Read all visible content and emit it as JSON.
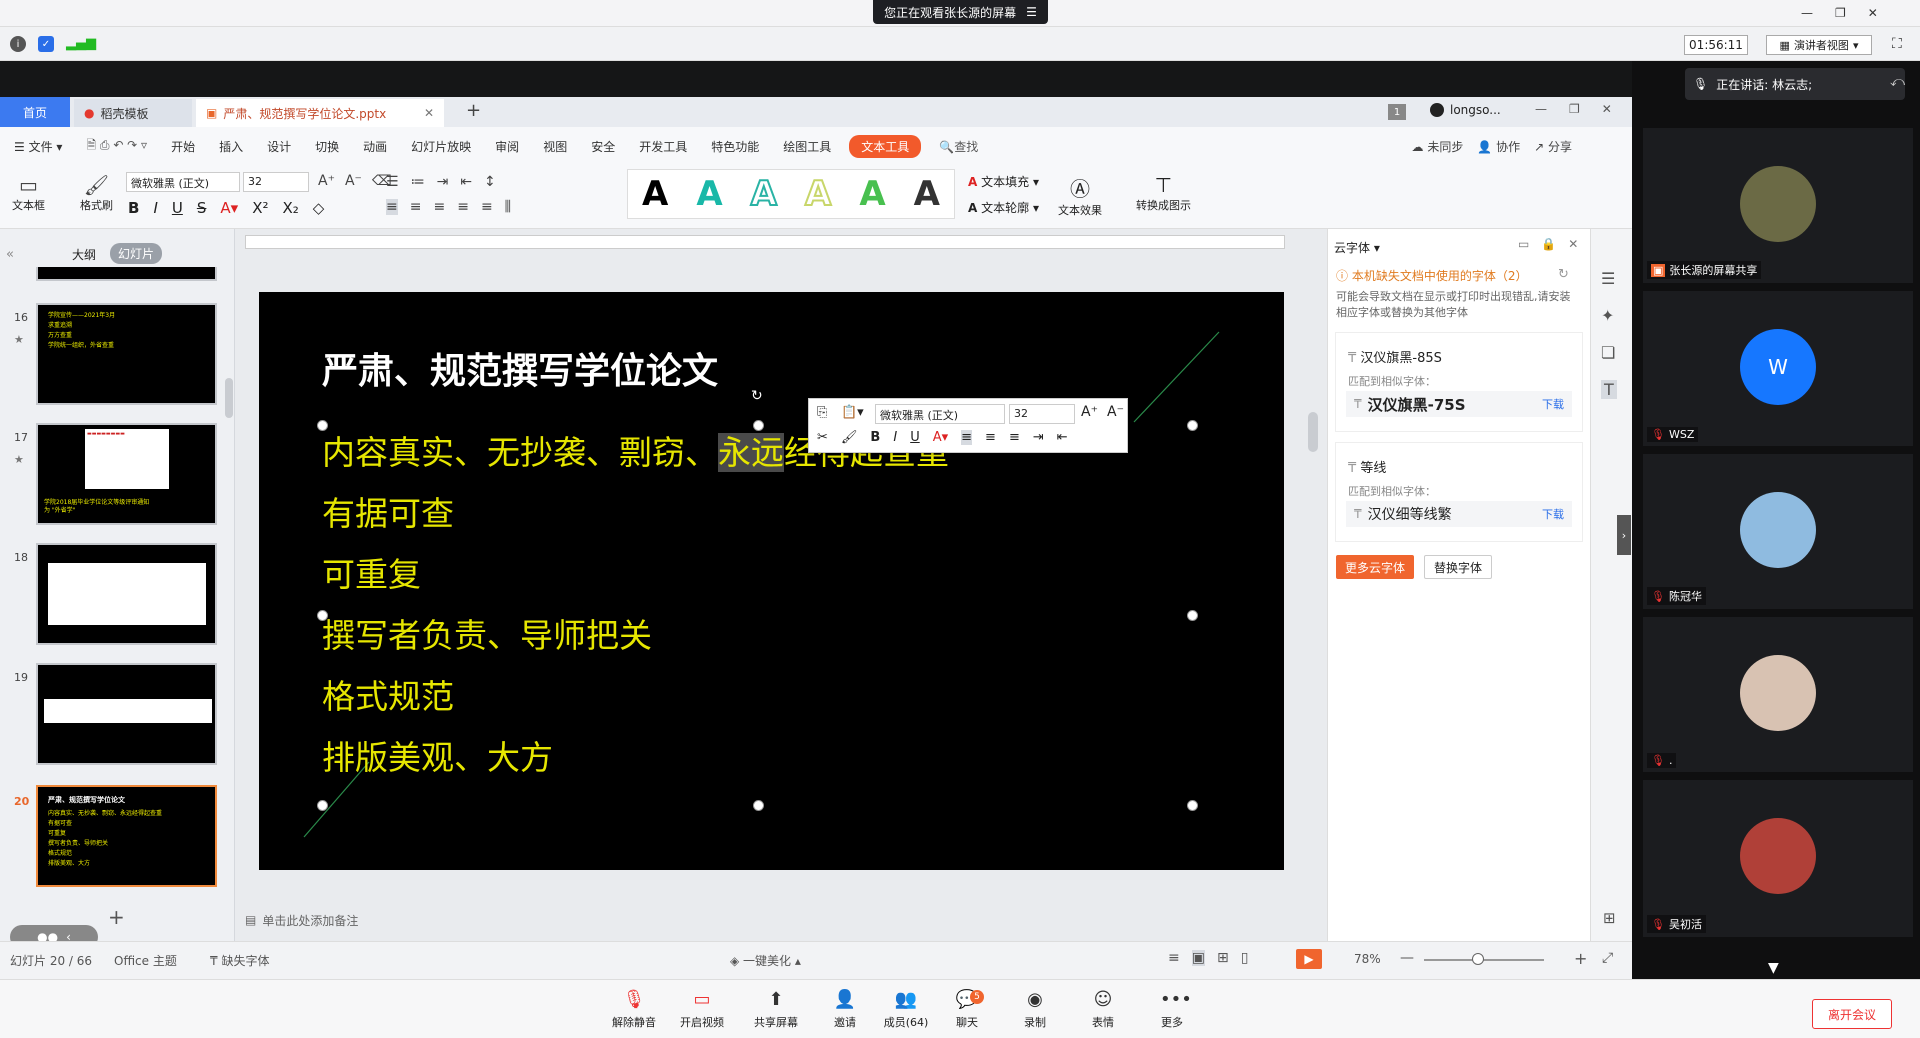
{
  "meeting": {
    "share_banner": "您正在观看张长源的屏幕",
    "timer": "01:56:11",
    "presenter_view": "演讲者视图",
    "speaking": "正在讲话: 林云志;",
    "toolbar": [
      {
        "label": "解除静音",
        "icon": "mic-muted-icon"
      },
      {
        "label": "开启视频",
        "icon": "camera-off-icon"
      },
      {
        "label": "共享屏幕",
        "icon": "share-screen-icon"
      },
      {
        "label": "邀请",
        "icon": "invite-icon"
      },
      {
        "label": "成员(64)",
        "icon": "members-icon"
      },
      {
        "label": "聊天",
        "icon": "chat-icon",
        "badge": "5"
      },
      {
        "label": "录制",
        "icon": "record-icon"
      },
      {
        "label": "表情",
        "icon": "emoji-icon"
      },
      {
        "label": "更多",
        "icon": "more-icon"
      }
    ],
    "leave": "离开会议",
    "participants": [
      {
        "name": "张长源的屏幕共享"
      },
      {
        "name": "WSZ",
        "initial": "W"
      },
      {
        "name": "陈冠华"
      },
      {
        "name": "."
      },
      {
        "name": "吴初活"
      }
    ]
  },
  "wps": {
    "tabs": {
      "home": "首页",
      "template": "稻壳模板",
      "doc": "严肃、规范撰写学位论文.pptx",
      "user": "longso...",
      "badge": "1"
    },
    "menu": {
      "file": "文件",
      "items": [
        "开始",
        "插入",
        "设计",
        "切换",
        "动画",
        "幻灯片放映",
        "审阅",
        "视图",
        "安全",
        "开发工具",
        "特色功能",
        "绘图工具"
      ],
      "active": "文本工具",
      "search": "查找",
      "sync": "未同步",
      "collab": "协作",
      "share": "分享"
    },
    "ribbon": {
      "textbox": "文本框",
      "format_painter": "格式刷",
      "font": "微软雅黑 (正文)",
      "size": "32",
      "fill": "文本填充",
      "outline": "文本轮廓",
      "effect": "文本效果",
      "convert": "转换成图示"
    },
    "view_tabs": {
      "outline": "大纲",
      "slides": "幻灯片"
    },
    "thumbs": [
      {
        "num": "16",
        "lines": [
          "学院宣传——2021年3月",
          "",
          "求重追溯",
          "万方查重",
          "学院统一组织，外省查重"
        ]
      },
      {
        "num": "17",
        "lines": [
          "学院2018届毕业学位论文等级评审通知",
          "为 \"外省学\""
        ]
      },
      {
        "num": "18",
        "lines": []
      },
      {
        "num": "19",
        "lines": []
      },
      {
        "num": "20",
        "lines": [
          "严肃、规范撰写学位论文",
          "内容真实、无抄袭、剽窃、永远经得起查重",
          "有据可查",
          "可重复",
          "撰写者负责、导师把关",
          "格式规范",
          "排版美观、大方"
        ]
      }
    ],
    "slide": {
      "title": "严肃、规范撰写学位论文",
      "bullets": [
        "内容真实、无抄袭、剽窃、永远经得起查重",
        "有据可查",
        "可重复",
        "撰写者负责、导师把关",
        "格式规范",
        "排版美观、大方"
      ],
      "selected_text": "永远"
    },
    "float_toolbar": {
      "font": "微软雅黑 (正文)",
      "size": "32"
    },
    "notes": "单击此处添加备注",
    "status": {
      "slide": "幻灯片 20 / 66",
      "theme": "Office 主题",
      "missing_font": "缺失字体",
      "beautify": "一键美化",
      "zoom": "78%"
    },
    "cloud_font": {
      "title": "云字体",
      "warning": "本机缺失文档中使用的字体（2）",
      "desc": "可能会导致文档在显示或打印时出现错乱,请安装相应字体或替换为其他字体",
      "fonts": [
        {
          "name": "汉仪旗黑-85S",
          "match_label": "匹配到相似字体：",
          "match": "汉仪旗黑-75S",
          "download": "下载"
        },
        {
          "name": "等线",
          "match_label": "匹配到相似字体：",
          "match": "汉仪细等线繁",
          "download": "下载"
        }
      ],
      "more_btn": "更多云字体",
      "replace_btn": "替换字体"
    }
  }
}
